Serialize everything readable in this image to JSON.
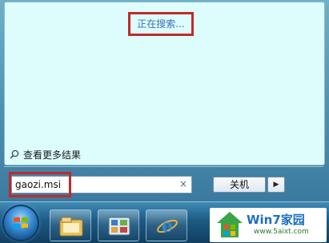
{
  "start_menu": {
    "status_text": "正在搜索...",
    "more_results_label": "查看更多结果",
    "search_value": "gaozi.msi",
    "clear_glyph": "×",
    "shutdown_label": "关机",
    "shutdown_arrow_glyph": "▶"
  },
  "taskbar": {
    "items": [
      {
        "icon": "file-explorer-icon"
      },
      {
        "icon": "control-panel-icon"
      },
      {
        "icon": "internet-explorer-icon"
      }
    ]
  },
  "watermark": {
    "title": "Win7家园",
    "url": "www.5aixt.com"
  },
  "colors": {
    "highlight_border": "#c02a2a",
    "status_text": "#3b6fb6",
    "results_bg": "#ddfdfd"
  }
}
